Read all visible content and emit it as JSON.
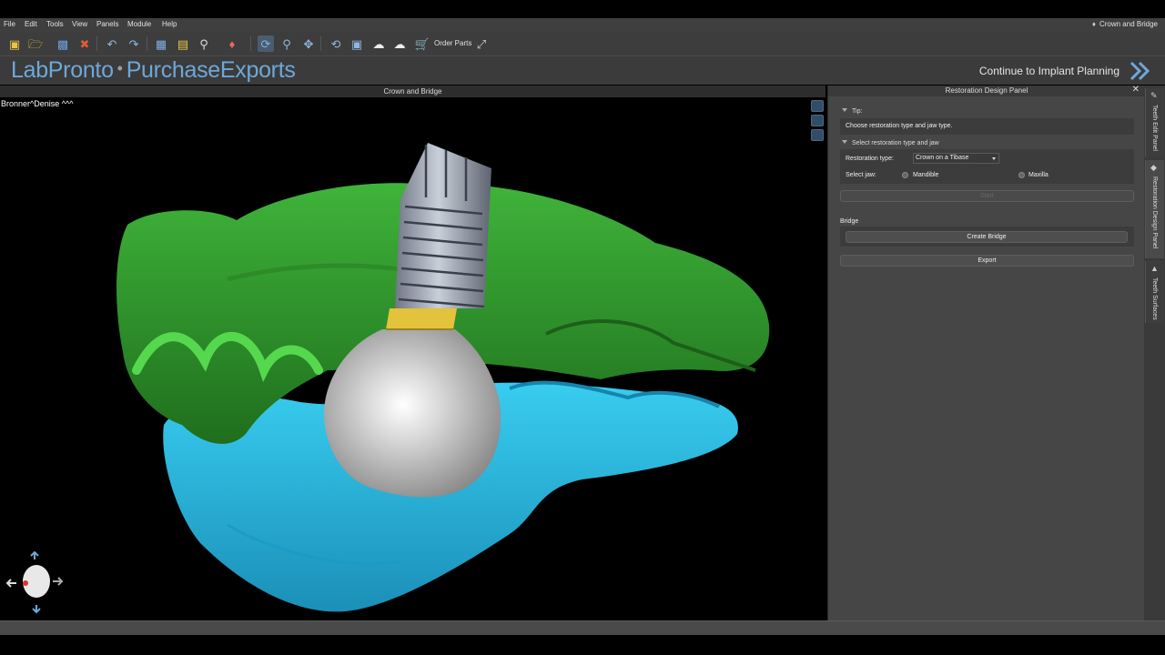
{
  "menu": {
    "items": [
      "File",
      "Edit",
      "Tools",
      "View",
      "Panels",
      "Module",
      "Help"
    ],
    "window_title": "Crown and Bridge"
  },
  "toolbar": {
    "order_parts": "Order Parts",
    "icons": [
      "new-file-icon",
      "open-folder-icon",
      "save-icon",
      "close-file-icon",
      "undo-icon",
      "redo-icon",
      "grid-view-icon",
      "report-icon",
      "search-document-icon",
      "tooth-icon",
      "rotate-view-icon",
      "zoom-icon",
      "pan-icon",
      "reset-rotation-icon",
      "fit-view-icon",
      "cloud-upload-icon",
      "cloud-icon",
      "cart-icon",
      "fullscreen-icon"
    ]
  },
  "brand": {
    "lab": "LabPronto",
    "separator": "•",
    "purchase": "PurchaseExports",
    "continue_label": "Continue to Implant Planning"
  },
  "viewport": {
    "title": "Crown and Bridge",
    "patient": "Bronner^Denise ^^^"
  },
  "panel": {
    "title": "Restoration Design Panel",
    "tip_heading": "Tip:",
    "tip_text": "Choose restoration type and jaw type.",
    "select_heading": "Select restoration type and jaw",
    "restoration_label": "Restoration type:",
    "restoration_value": "Crown on a Tibase",
    "jaw_label": "Select jaw:",
    "mandible": "Mandible",
    "maxilla": "Maxilla",
    "start": "Start",
    "bridge_heading": "Bridge",
    "create_bridge": "Create Bridge",
    "export": "Export"
  },
  "side_tabs": [
    "Teeth Edit Panel",
    "Restoration Design Panel",
    "Teeth Surfaces"
  ],
  "colors": {
    "accent_blue": "#6ea8d8",
    "upper_jaw": "#2f9a2a",
    "lower_jaw": "#23b8e0",
    "crown": "#d6d6d6",
    "implant": "#a8b0bd",
    "tibase_ring": "#e3c23c"
  }
}
